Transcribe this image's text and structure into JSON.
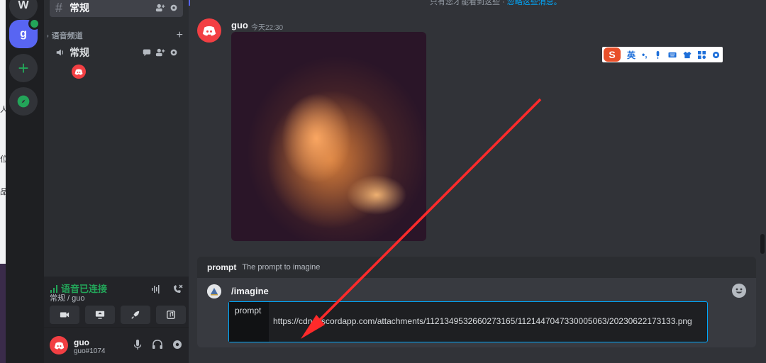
{
  "servers": {
    "w_label": "W",
    "g_label": "g",
    "add_label": "+"
  },
  "channels": {
    "text_channel": "常规",
    "voice_category": "语音频道",
    "voice_channel": "常规"
  },
  "voice_connection": {
    "status": "语音已连接",
    "sub": "常规 / guo"
  },
  "user": {
    "name": "guo",
    "tag": "guo#1074"
  },
  "message": {
    "author": "guo",
    "time": "今天22:30",
    "top_note_prefix": "只有您才能看到这些 · ",
    "top_note_link": "忽略这些消息。"
  },
  "ime_toolbar": {
    "logo": "S",
    "mode": "英",
    "punct": "•,"
  },
  "command": {
    "hint_key": "prompt",
    "hint_desc": "The prompt to imagine",
    "name": "/imagine",
    "option_label": "prompt",
    "option_value": "https://cdn.discordapp.com/attachments/1121349532660273165/1121447047330005063/20230622173133.png"
  },
  "colors": {
    "accent": "#5865f2",
    "online": "#23a559",
    "danger": "#f23f43",
    "link": "#00a8fc",
    "arrow": "#ff2a2a"
  },
  "icons": [
    "hash-icon",
    "speaker-icon",
    "add-member-icon",
    "gear-icon",
    "chat-icon",
    "video-icon",
    "screen-share-icon",
    "rocket-icon",
    "soundboard-icon",
    "mic-icon",
    "headphones-icon",
    "phone-disconnect-icon",
    "signal-icon",
    "explore-icon",
    "emoji-icon",
    "discord-logo-icon"
  ]
}
